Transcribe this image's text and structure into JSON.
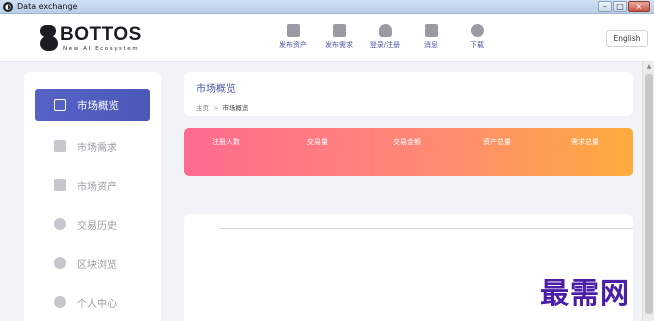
{
  "window": {
    "title": "Data exchange",
    "app_icon": "circle-logo-icon"
  },
  "brand": {
    "name": "BOTTOS",
    "tagline": "New AI Ecosystem"
  },
  "nav": [
    {
      "label": "发布资产",
      "icon": "publish-asset-icon"
    },
    {
      "label": "发布需求",
      "icon": "publish-demand-icon"
    },
    {
      "label": "登录/注册",
      "icon": "user-icon"
    },
    {
      "label": "消息",
      "icon": "message-icon"
    },
    {
      "label": "下载",
      "icon": "download-icon"
    }
  ],
  "language_button": "English",
  "sidebar": [
    {
      "label": "市场概览",
      "icon": "chart-icon",
      "active": true
    },
    {
      "label": "市场需求",
      "icon": "document-icon"
    },
    {
      "label": "市场资产",
      "icon": "store-icon"
    },
    {
      "label": "交易历史",
      "icon": "clock-icon"
    },
    {
      "label": "区块浏览",
      "icon": "globe-icon"
    },
    {
      "label": "个人中心",
      "icon": "person-icon"
    }
  ],
  "page": {
    "title": "市场概览",
    "breadcrumb": {
      "home": "主页",
      "separator": ">",
      "current": "市场概览"
    }
  },
  "stats": [
    "注册人数",
    "交易量",
    "交易金额",
    "资产总量",
    "需求总量"
  ],
  "watermark": "最需网",
  "colors": {
    "accent": "#4c58b8",
    "nav_label": "#4a56a6",
    "banner_start": "#ff6a8f",
    "banner_end": "#ffab3e"
  }
}
